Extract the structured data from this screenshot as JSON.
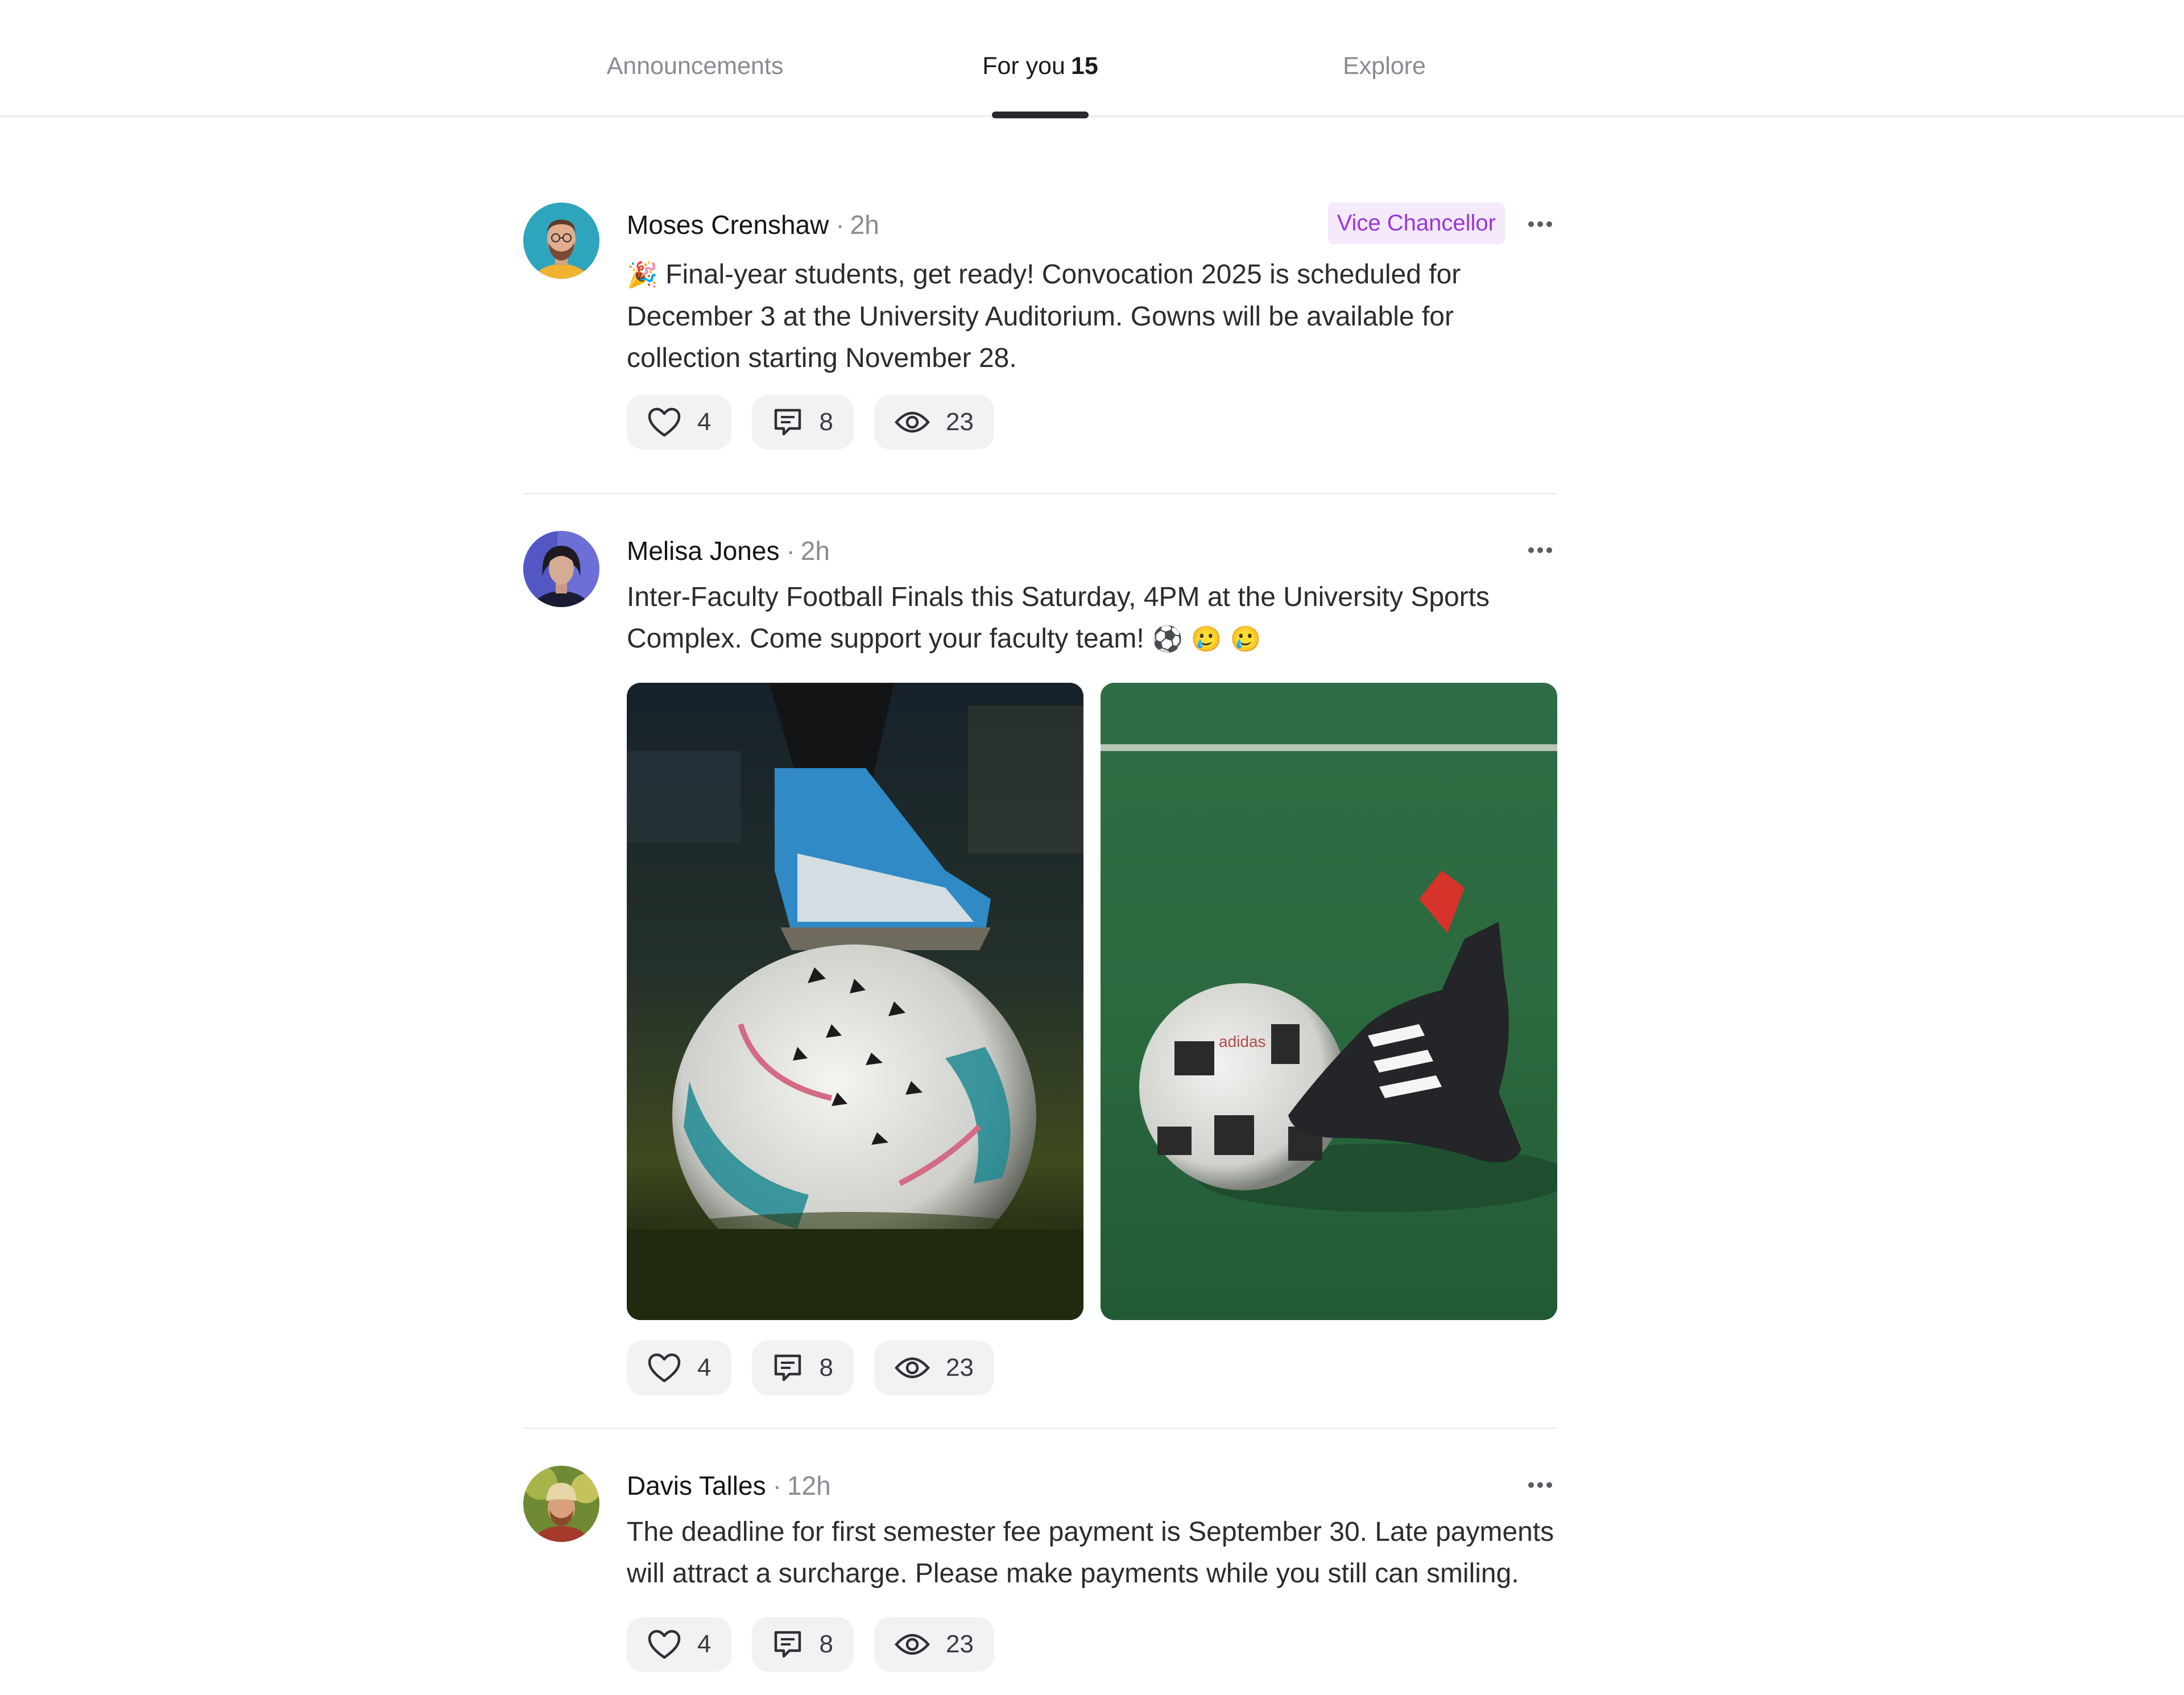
{
  "tabs": [
    {
      "label": "Announcements",
      "count": ""
    },
    {
      "label": "For you",
      "count": "15"
    },
    {
      "label": "Explore",
      "count": ""
    }
  ],
  "active_tab": "For you",
  "posts": [
    {
      "author": "Moses Crenshaw",
      "time": "2h",
      "badge": "Vice Chancellor",
      "emoji_prefix": "🎉",
      "text": "Final-year students, get ready! Convocation 2025 is scheduled for December 3 at the University Auditorium. Gowns will be available for collection starting November 28.",
      "likes": "4",
      "comments": "8",
      "views": "23"
    },
    {
      "author": "Melisa Jones",
      "time": "2h",
      "text": "Inter-Faculty Football Finals this Saturday, 4PM at the University Sports Complex. Come support your faculty team!",
      "emoji_suffix": "⚽ 🥲 🥲",
      "likes": "4",
      "comments": "8",
      "views": "23"
    },
    {
      "author": "Davis Talles",
      "time": "12h",
      "text": "The deadline for first semester fee payment is September 30. Late payments will attract a surcharge. Please make payments while you still can smiling.",
      "likes": "4",
      "comments": "8",
      "views": "23"
    }
  ],
  "colors": {
    "accent_badge_bg": "#f4e9fd",
    "accent_badge_text": "#9a36d8",
    "tab_indicator": "#2a2a2e"
  }
}
